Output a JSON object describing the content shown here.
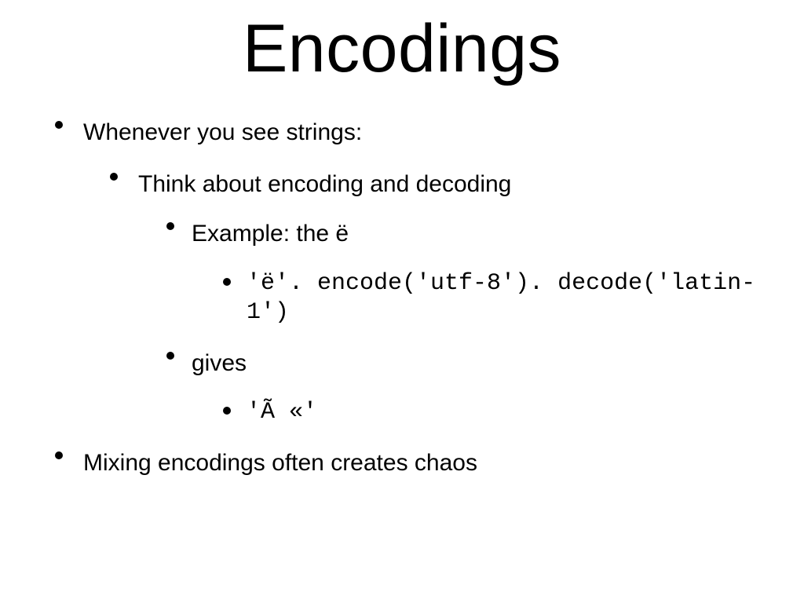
{
  "title": "Encodings",
  "bullets": {
    "lv1_a": "Whenever you see strings:",
    "lv2_a": "Think about encoding and decoding",
    "lv3_a": "Example: the ë",
    "lv4_a": "'ë'. encode('utf-8'). decode('latin-1')",
    "lv3_b": "gives",
    "lv4_b": "'Ã «'",
    "lv1_b": "Mixing encodings often creates chaos"
  }
}
